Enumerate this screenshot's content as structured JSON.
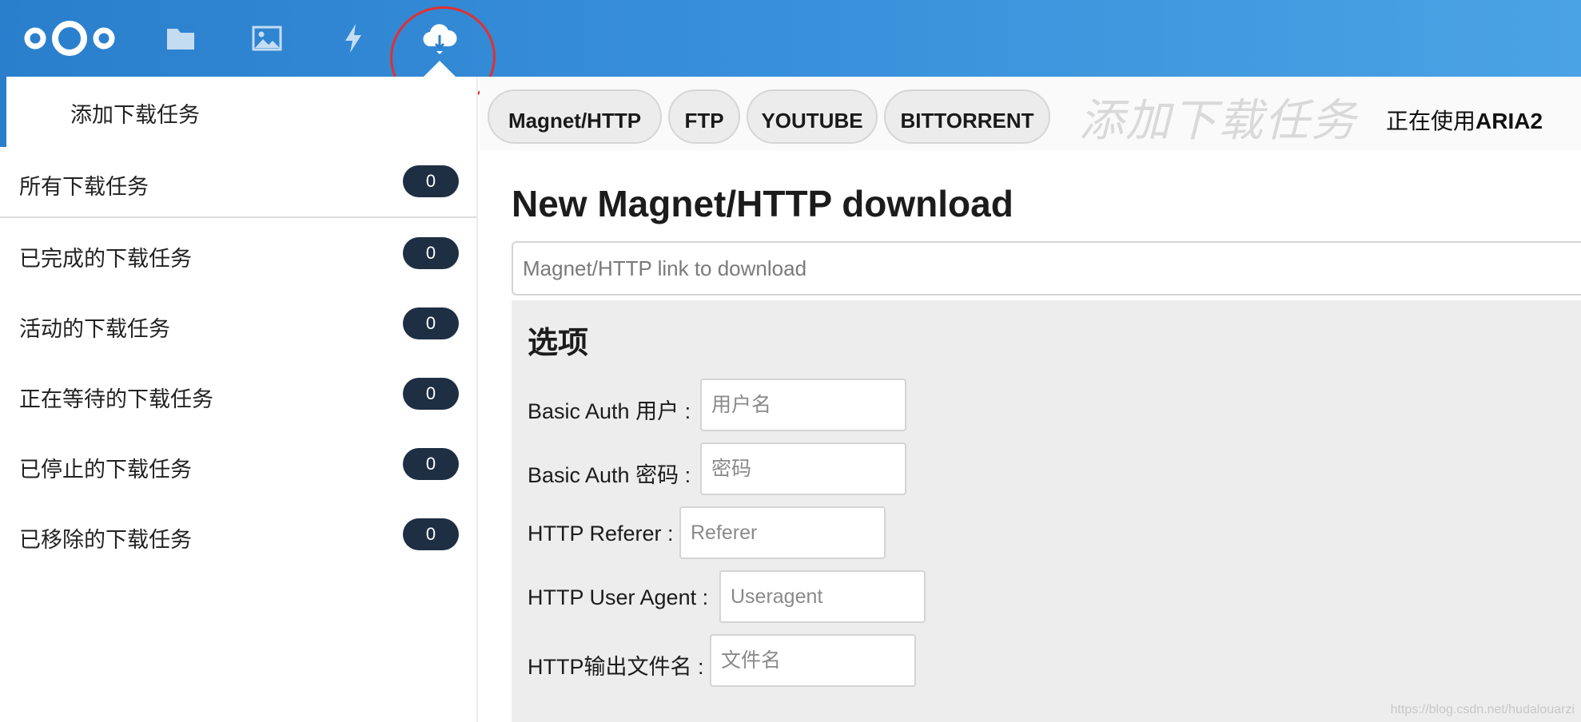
{
  "header": {
    "apps": [
      {
        "name": "files",
        "icon": "folder-icon"
      },
      {
        "name": "gallery",
        "icon": "image-icon"
      },
      {
        "name": "activity",
        "icon": "lightning-icon"
      },
      {
        "name": "downloader",
        "icon": "cloud-download-icon",
        "active": true
      }
    ],
    "colors": {
      "bar": "#2a7fcc",
      "annotation": "#e23030"
    }
  },
  "sidebar": {
    "add_label": "添加下载任务",
    "items": [
      {
        "label": "所有下载任务",
        "count": "0"
      },
      {
        "label": "已完成的下载任务",
        "count": "0"
      },
      {
        "label": "活动的下载任务",
        "count": "0"
      },
      {
        "label": "正在等待的下载任务",
        "count": "0"
      },
      {
        "label": "已停止的下载任务",
        "count": "0"
      },
      {
        "label": "已移除的下载任务",
        "count": "0"
      }
    ]
  },
  "tabs": [
    {
      "label": "Magnet/HTTP",
      "active": true
    },
    {
      "label": "FTP"
    },
    {
      "label": "YOUTUBE"
    },
    {
      "label": "BITTORRENT"
    }
  ],
  "toolbar": {
    "watermark_title": "添加下载任务",
    "engine_prefix": "正在使用",
    "engine_name": "ARIA2"
  },
  "main": {
    "title": "New Magnet/HTTP download",
    "url_placeholder": "Magnet/HTTP link to download"
  },
  "options": {
    "heading": "选项",
    "fields": {
      "user": {
        "label": "Basic Auth 用户 :",
        "placeholder": "用户名"
      },
      "pass": {
        "label": "Basic Auth 密码 :",
        "placeholder": "密码"
      },
      "referer": {
        "label": "HTTP Referer :",
        "placeholder": "Referer"
      },
      "ua": {
        "label": "HTTP User Agent :",
        "placeholder": "Useragent"
      },
      "out": {
        "label": "HTTP输出文件名 :",
        "placeholder": "文件名"
      }
    }
  },
  "watermark": "https://blog.csdn.net/hudalouarzi"
}
